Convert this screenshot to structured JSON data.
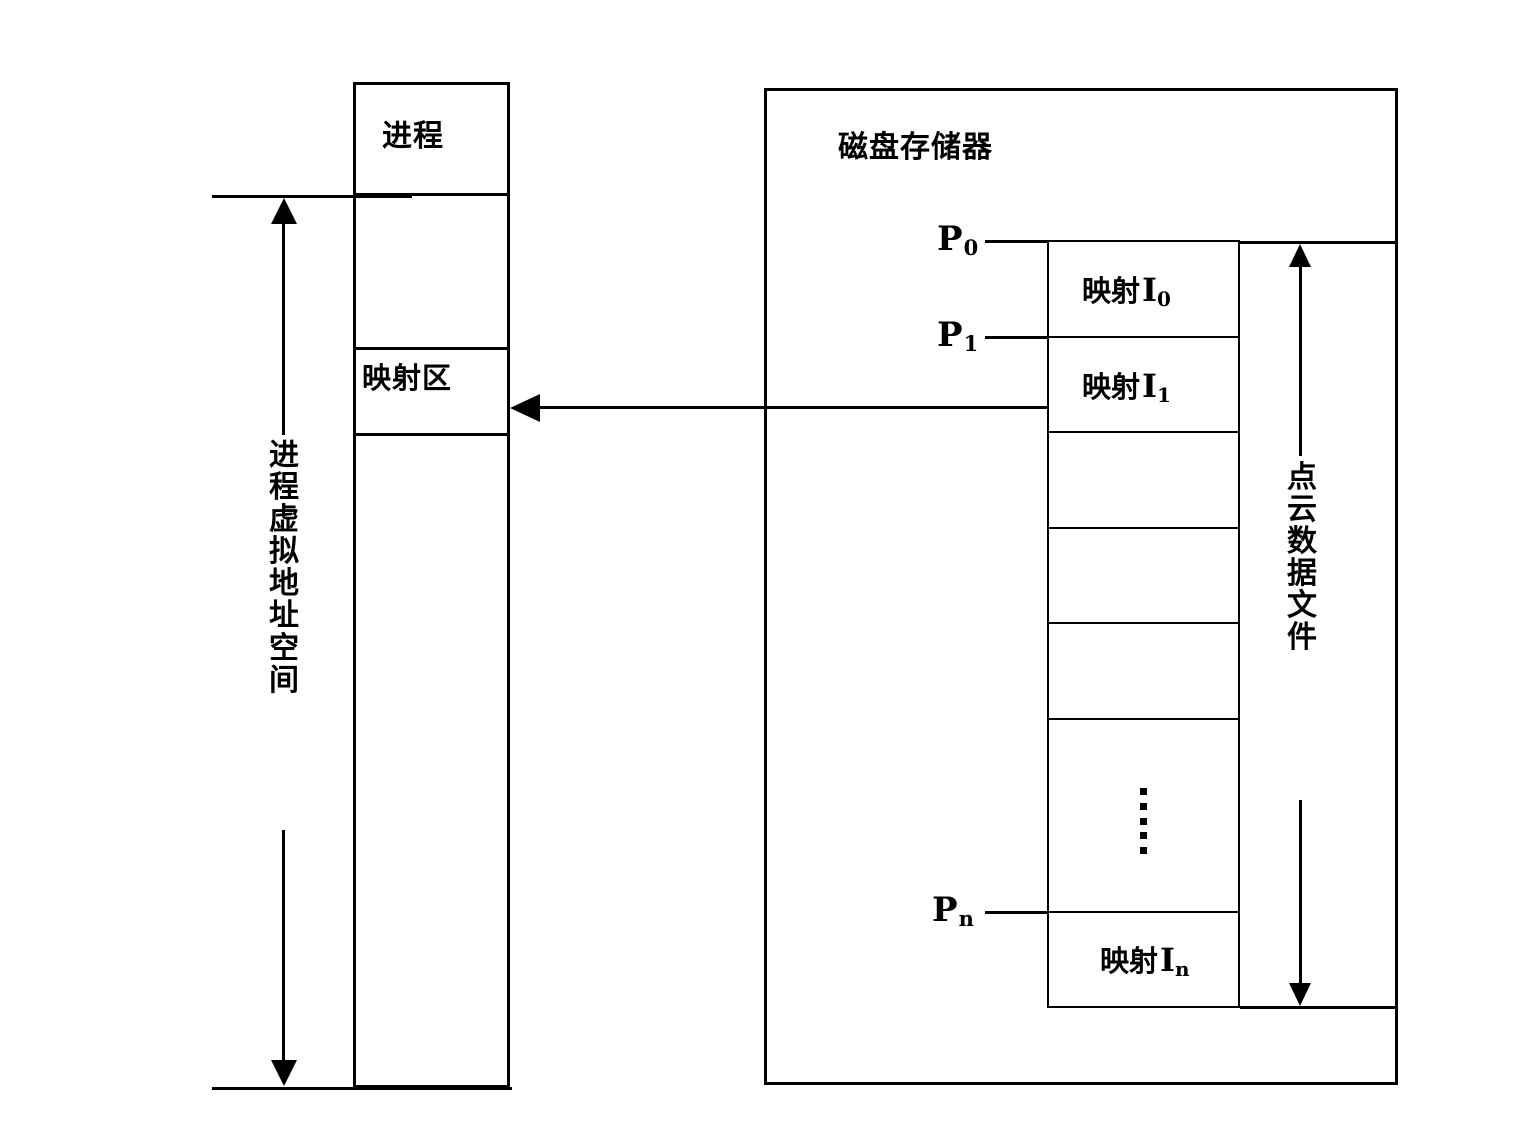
{
  "diagram": {
    "title_disk": "磁盘存储器",
    "left_column": {
      "process_label": "进程",
      "mapping_area_label": "映射区",
      "axis_label_chars": [
        "进",
        "程",
        "虚",
        "拟",
        "地",
        "址",
        "空",
        "间"
      ],
      "axis_label_text": "进程虚拟地址空间"
    },
    "right_panel": {
      "file_axis_label_chars": [
        "点",
        "云",
        "数",
        "据",
        "文",
        "件"
      ],
      "file_axis_label_text": "点云数据文件",
      "pointers": [
        {
          "name": "P",
          "sub": "0"
        },
        {
          "name": "P",
          "sub": "1"
        },
        {
          "name": "P",
          "sub": "n"
        }
      ],
      "blocks": [
        {
          "prefix": "映射",
          "symbol": "I",
          "sub": "0"
        },
        {
          "prefix": "映射",
          "symbol": "I",
          "sub": "1"
        },
        {
          "prefix": "映射",
          "symbol": "I",
          "sub": "n"
        }
      ],
      "ellipsis": "⋮"
    },
    "connector": {
      "direction": "left",
      "from": "映射I1",
      "to": "映射区"
    },
    "colors": {
      "stroke": "#000000",
      "background": "#ffffff"
    }
  }
}
